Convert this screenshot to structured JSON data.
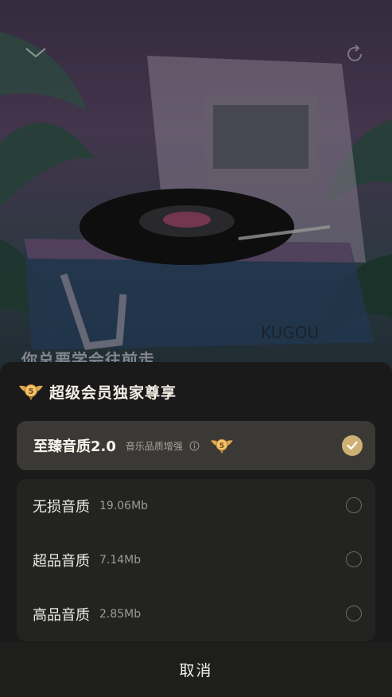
{
  "background": {
    "lyric_text": "你总要学会往前走",
    "brand_text": "KUGOU"
  },
  "sheet": {
    "title": "超级会员独家尊享",
    "vip_badge_text": "5",
    "selected_option": {
      "name": "至臻音质2.0",
      "description": "音乐品质增强",
      "checked": true
    },
    "options": [
      {
        "name": "无损音质",
        "size": "19.06Mb",
        "checked": false
      },
      {
        "name": "超品音质",
        "size": "7.14Mb",
        "checked": false
      },
      {
        "name": "高品音质",
        "size": "2.85Mb",
        "checked": false
      }
    ],
    "cancel_label": "取消"
  },
  "colors": {
    "accent_gold": "#cdb074",
    "sheet_bg": "#191a19",
    "selected_card_bg": "#3a3935",
    "list_card_bg": "#232322"
  },
  "icons": {
    "top_left": "chevron-down-icon",
    "top_right": "refresh-icon",
    "badge": "vip-wings-badge-icon",
    "info": "info-circle-icon",
    "check": "checkmark-icon"
  }
}
